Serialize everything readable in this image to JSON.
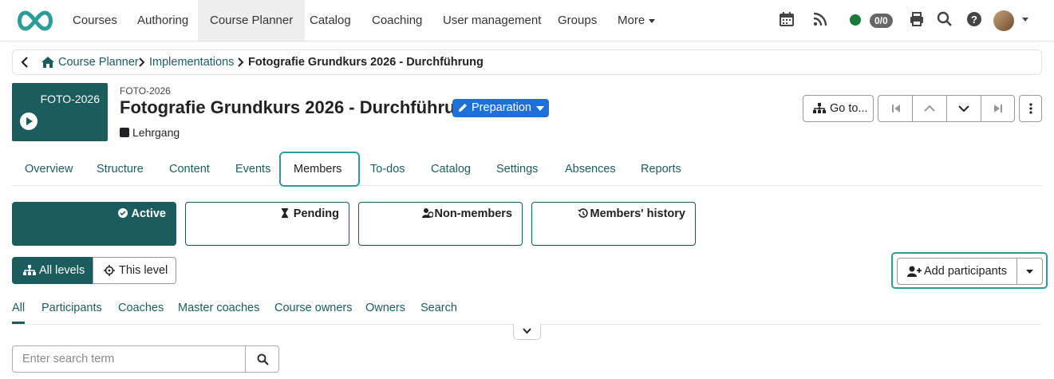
{
  "nav": {
    "items": [
      "Courses",
      "Authoring",
      "Course Planner",
      "Catalog",
      "Coaching",
      "User management",
      "Groups",
      "More"
    ],
    "active": "Course Planner",
    "counter": "0/0",
    "icons": [
      "calendar-icon",
      "rss-icon",
      "status-online-icon",
      "print-icon",
      "search-icon",
      "help-icon",
      "avatar",
      "user-menu-caret-icon"
    ],
    "status_color": "#1a7a3a"
  },
  "breadcrumb": {
    "items": [
      "Course Planner",
      "Implementations",
      "Fotografie Grundkurs 2026 - Durchführung"
    ]
  },
  "header": {
    "thumb_label": "FOTO-2026",
    "external_ref": "FOTO-2026",
    "title": "Fotografie Grundkurs 2026 - Durchführung",
    "type": "Lehrgang",
    "status": "Preparation",
    "goto_label": "Go to..."
  },
  "tabs": [
    "Overview",
    "Structure",
    "Content",
    "Events",
    "Members",
    "To-dos",
    "Catalog",
    "Settings",
    "Absences",
    "Reports"
  ],
  "active_tab": "Members",
  "member_cards": [
    "Active",
    "Pending",
    "Non-members",
    "Members' history"
  ],
  "levels": {
    "all": "All levels",
    "this": "This level"
  },
  "add_participants": "Add participants",
  "roles": [
    "All",
    "Participants",
    "Coaches",
    "Master coaches",
    "Course owners",
    "Owners",
    "Search"
  ],
  "search": {
    "placeholder": "Enter search term"
  },
  "colors": {
    "primary": "#1b5c5e",
    "highlight": "#2a9d99",
    "status_blue": "#1e6fd9"
  }
}
